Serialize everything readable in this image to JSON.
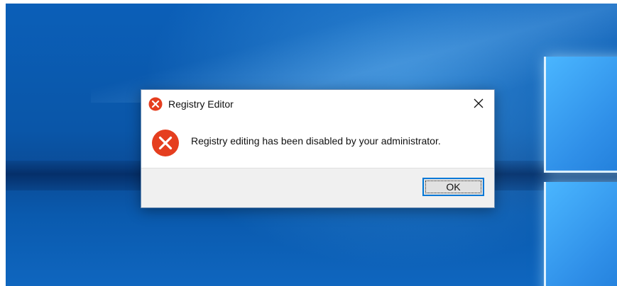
{
  "dialog": {
    "title": "Registry Editor",
    "title_icon": "error-icon",
    "close_icon": "close-icon",
    "message_icon": "error-icon",
    "message": "Registry editing has been disabled by your administrator.",
    "ok_label": "OK"
  },
  "colors": {
    "error_red": "#e53e1f",
    "accent_blue": "#0078d7",
    "desktop_blue": "#0a56a8"
  }
}
